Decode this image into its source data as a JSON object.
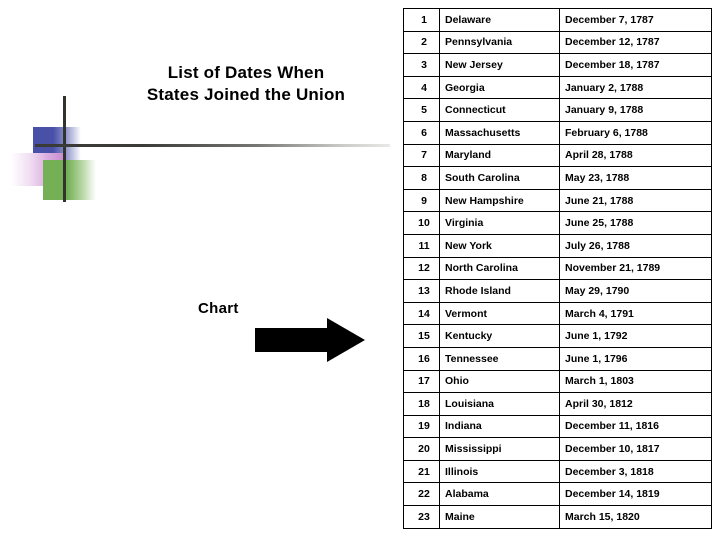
{
  "slide": {
    "title_line1": "List of Dates When",
    "title_line2": "States Joined the Union",
    "chart_label": "Chart"
  },
  "theme": {
    "blue": "#4850a8",
    "pink": "#c98fd0",
    "green": "#74b055",
    "rule": "#3a3a36",
    "text": "#000000",
    "background": "#ffffff"
  },
  "table": {
    "rows": [
      {
        "num": "1",
        "state": "Delaware",
        "date": "December 7, 1787"
      },
      {
        "num": "2",
        "state": "Pennsylvania",
        "date": "December 12, 1787"
      },
      {
        "num": "3",
        "state": "New Jersey",
        "date": "December 18, 1787"
      },
      {
        "num": "4",
        "state": "Georgia",
        "date": "January 2, 1788"
      },
      {
        "num": "5",
        "state": "Connecticut",
        "date": "January 9, 1788"
      },
      {
        "num": "6",
        "state": "Massachusetts",
        "date": "February 6, 1788"
      },
      {
        "num": "7",
        "state": "Maryland",
        "date": "April 28, 1788"
      },
      {
        "num": "8",
        "state": "South Carolina",
        "date": "May 23, 1788"
      },
      {
        "num": "9",
        "state": "New Hampshire",
        "date": "June 21, 1788"
      },
      {
        "num": "10",
        "state": "Virginia",
        "date": "June 25, 1788"
      },
      {
        "num": "11",
        "state": "New York",
        "date": "July 26, 1788"
      },
      {
        "num": "12",
        "state": "North Carolina",
        "date": "November 21, 1789"
      },
      {
        "num": "13",
        "state": "Rhode Island",
        "date": "May 29, 1790"
      },
      {
        "num": "14",
        "state": "Vermont",
        "date": "March 4, 1791"
      },
      {
        "num": "15",
        "state": "Kentucky",
        "date": "June 1, 1792"
      },
      {
        "num": "16",
        "state": "Tennessee",
        "date": "June 1, 1796"
      },
      {
        "num": "17",
        "state": "Ohio",
        "date": "March 1, 1803"
      },
      {
        "num": "18",
        "state": "Louisiana",
        "date": "April 30, 1812"
      },
      {
        "num": "19",
        "state": "Indiana",
        "date": "December 11, 1816"
      },
      {
        "num": "20",
        "state": "Mississippi",
        "date": "December 10, 1817"
      },
      {
        "num": "21",
        "state": "Illinois",
        "date": "December 3, 1818"
      },
      {
        "num": "22",
        "state": "Alabama",
        "date": "December 14, 1819"
      },
      {
        "num": "23",
        "state": "Maine",
        "date": "March 15, 1820"
      }
    ]
  }
}
